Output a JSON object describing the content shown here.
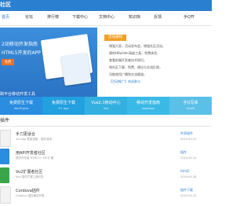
{
  "header": {
    "logo": "社区",
    "logo_sub": "dcloud.io",
    "nav": [
      "首页",
      "论坛",
      "排行榜",
      "下载中心",
      "文档中心",
      "知识库",
      "反馈",
      "手Q开"
    ],
    "accent": "#2a7fd0"
  },
  "banner": {
    "line1": "2动移动开发指南",
    "line2": "HTML5开发的APP",
    "chip": "免费",
    "footer": "跨平台移动开发工具"
  },
  "promo": {
    "badge": "活动通知",
    "lines": [
      "增强大家，活动发布会，增强社区活动，",
      "建的HBuilder高级工具，免费体验，",
      "查看前端开发者技术知识。",
      "和社区下载、免费、建议与交流反馈，",
      "功能使用广播和交流渠道。",
      "【活动推广】欢迎参与"
    ]
  },
  "tiles": [
    {
      "title": "免费原生下载",
      "sub": "html5 plus",
      "color": "#2a8de0"
    },
    {
      "title": "免费原生下载",
      "sub": "5+ App",
      "color": "#23a0e0"
    },
    {
      "title": "Vue2.1移动中心",
      "sub": "mui",
      "color": "#34b0e0"
    },
    {
      "title": "移动开发指南",
      "sub": "wap2app",
      "color": "#3bb9e6"
    },
    {
      "title": "手Q写体",
      "sub": "html5",
      "color": "#5bc0e8"
    }
  ],
  "section": {
    "title": "插件"
  },
  "rows": [
    {
      "title": "手刀更适合",
      "sub": "uni-app 框架适配 - 插件适用",
      "right_link": "共享插件",
      "right": "2019-05-21"
    },
    {
      "title": "用API开发者社区",
      "sub": "提供开发者 HTML5+ API 扩展",
      "right_link": "插件",
      "right": "2019-05-14"
    },
    {
      "title": "Vu2扩展者社区",
      "sub": "Vue 插件扩展工具开发",
      "right_link": "html5",
      "right": "2019-04-28"
    },
    {
      "title": "Cordova插件",
      "sub": "Cordova 插件兼容列表",
      "right_link": "插件下载",
      "right": "2019-04-10"
    }
  ]
}
